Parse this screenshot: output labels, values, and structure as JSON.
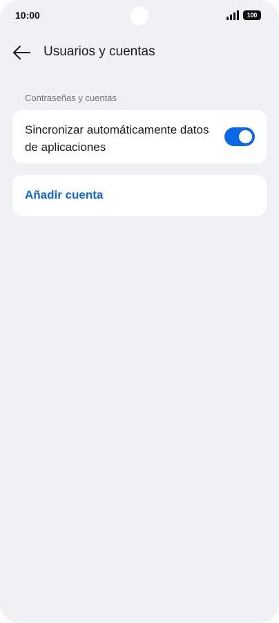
{
  "status_bar": {
    "time": "10:00",
    "battery_level": "100",
    "signal_icon": "signal-bars-icon"
  },
  "header": {
    "back_icon": "arrow-left-icon",
    "title": "Usuarios y cuentas"
  },
  "section": {
    "label": "Contraseñas y cuentas"
  },
  "sync_setting": {
    "label": "Sincronizar automáticamente datos de aplicaciones",
    "enabled": true
  },
  "add_account": {
    "label": "Añadir cuenta"
  },
  "colors": {
    "background": "#eff1f4",
    "card": "#ffffff",
    "accent": "#0a67e6",
    "text_primary": "#1a1a1a",
    "text_secondary": "#6f7276"
  }
}
